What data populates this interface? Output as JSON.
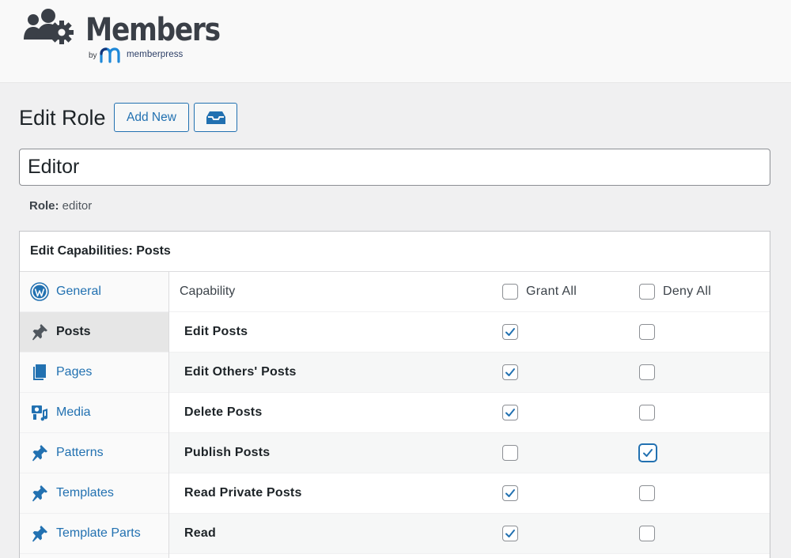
{
  "brand": {
    "title": "Members",
    "by": "by",
    "partner": "memberpress"
  },
  "page": {
    "title": "Edit Role",
    "add_new_label": "Add New",
    "secondary_icon": "inbox-tray-icon"
  },
  "role": {
    "name_value": "Editor",
    "slug_label": "Role:",
    "slug_value": "editor"
  },
  "capabilities": {
    "heading": "Edit Capabilities: Posts",
    "column_capability": "Capability",
    "grant_all_label": "Grant All",
    "deny_all_label": "Deny All",
    "grant_all_checked": false,
    "deny_all_checked": false,
    "rows": [
      {
        "name": "Edit Posts",
        "grant": true,
        "deny": false
      },
      {
        "name": "Edit Others' Posts",
        "grant": true,
        "deny": false
      },
      {
        "name": "Delete Posts",
        "grant": true,
        "deny": false
      },
      {
        "name": "Publish Posts",
        "grant": false,
        "deny": true
      },
      {
        "name": "Read Private Posts",
        "grant": true,
        "deny": false
      },
      {
        "name": "Read",
        "grant": true,
        "deny": false
      }
    ]
  },
  "nav": {
    "items": [
      {
        "label": "General",
        "icon": "wordpress-icon",
        "active": false
      },
      {
        "label": "Posts",
        "icon": "pin-icon",
        "active": true
      },
      {
        "label": "Pages",
        "icon": "pages-icon",
        "active": false
      },
      {
        "label": "Media",
        "icon": "media-icon",
        "active": false
      },
      {
        "label": "Patterns",
        "icon": "pin-icon",
        "active": false
      },
      {
        "label": "Templates",
        "icon": "pin-icon",
        "active": false
      },
      {
        "label": "Template Parts",
        "icon": "pin-icon",
        "active": false
      }
    ]
  },
  "colors": {
    "accent": "#2271b1",
    "check": "#2271b1",
    "brand_text": "#3a3f47"
  }
}
